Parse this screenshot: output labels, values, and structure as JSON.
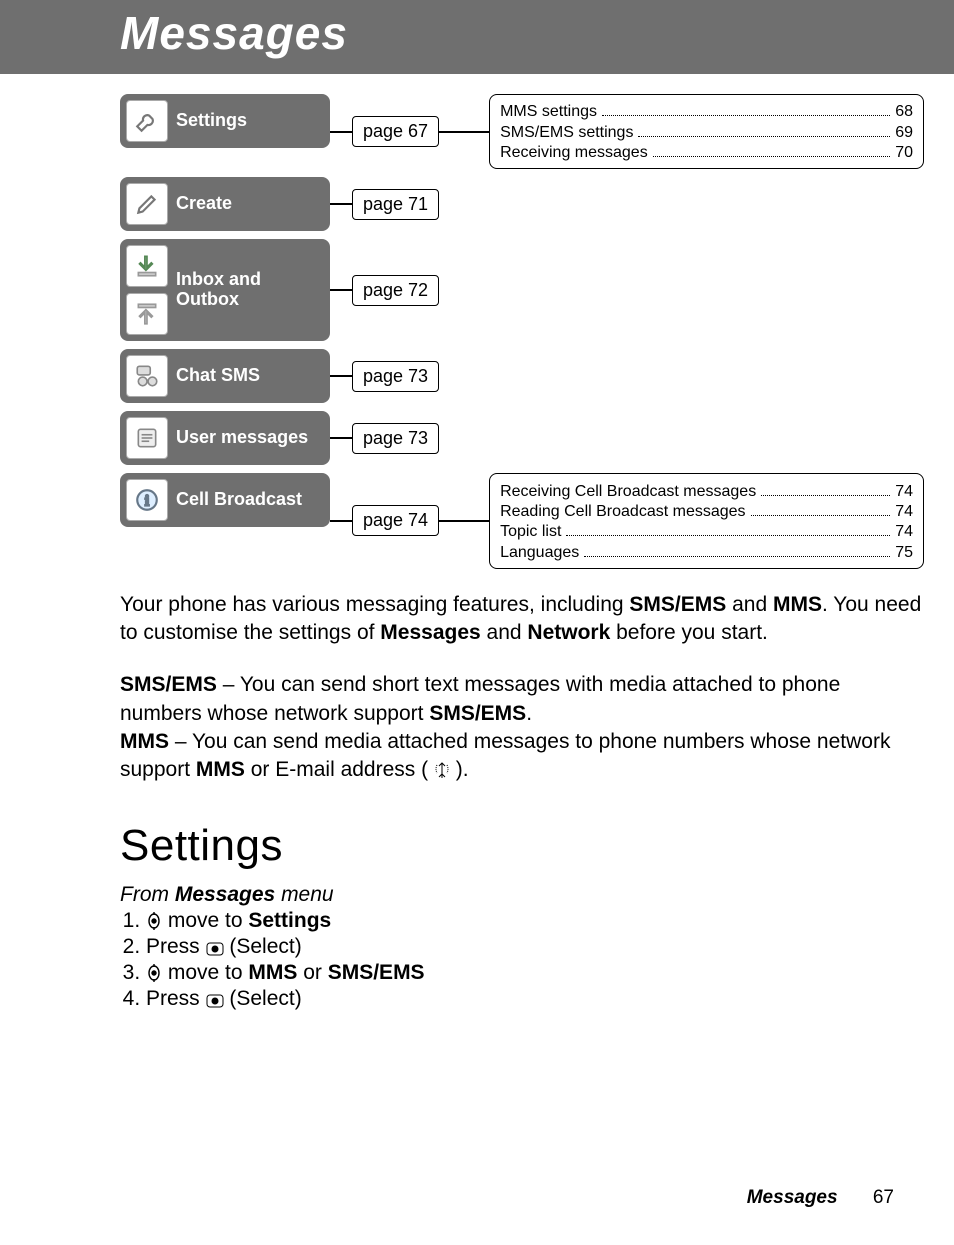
{
  "header": {
    "title": "Messages"
  },
  "menu": [
    {
      "label": "Settings",
      "page": "page 67",
      "sub": [
        {
          "title": "MMS settings",
          "page": "68"
        },
        {
          "title": "SMS/EMS settings",
          "page": "69"
        },
        {
          "title": "Receiving messages",
          "page": "70"
        }
      ]
    },
    {
      "label": "Create",
      "page": "page 71",
      "sub": []
    },
    {
      "label": "Inbox and Outbox",
      "page": "page 72",
      "sub": []
    },
    {
      "label": "Chat SMS",
      "page": "page 73",
      "sub": []
    },
    {
      "label": "User messages",
      "page": "page 73",
      "sub": []
    },
    {
      "label": "Cell Broadcast",
      "page": "page 74",
      "sub": [
        {
          "title": "Receiving Cell Broadcast messages",
          "page": "74"
        },
        {
          "title": "Reading Cell Broadcast messages",
          "page": "74"
        },
        {
          "title": "Topic list",
          "page": "74"
        },
        {
          "title": "Languages",
          "page": "75"
        }
      ]
    }
  ],
  "intro": {
    "p1a": "Your phone has various messaging features, including ",
    "p1b": "SMS/EMS",
    "p1c": " and ",
    "p1d": "MMS",
    "p1e": ". You need to customise the settings of ",
    "p1f": "Messages",
    "p1g": " and ",
    "p1h": "Network",
    "p1i": " before you start.",
    "p2a": "SMS/EMS",
    "p2b": " – You can send short text messages with media attached to phone numbers whose network support ",
    "p2c": "SMS/EMS",
    "p2d": ".",
    "p3a": "MMS",
    "p3b": " – You can send media attached messages to phone numbers whose network support ",
    "p3c": "MMS",
    "p3d": " or E-mail address ( ",
    "p3e": " )."
  },
  "section": {
    "title": "Settings",
    "from_a": "From ",
    "from_b": "Messages",
    "from_c": " menu",
    "steps": {
      "s1a": " move to ",
      "s1b": "Settings",
      "s2a": "Press ",
      "s2b": " (Select)",
      "s3a": " move to ",
      "s3b": "MMS",
      "s3c": " or ",
      "s3d": "SMS/EMS",
      "s4a": "Press ",
      "s4b": " (Select)"
    }
  },
  "footer": {
    "section": "Messages",
    "page": "67"
  }
}
